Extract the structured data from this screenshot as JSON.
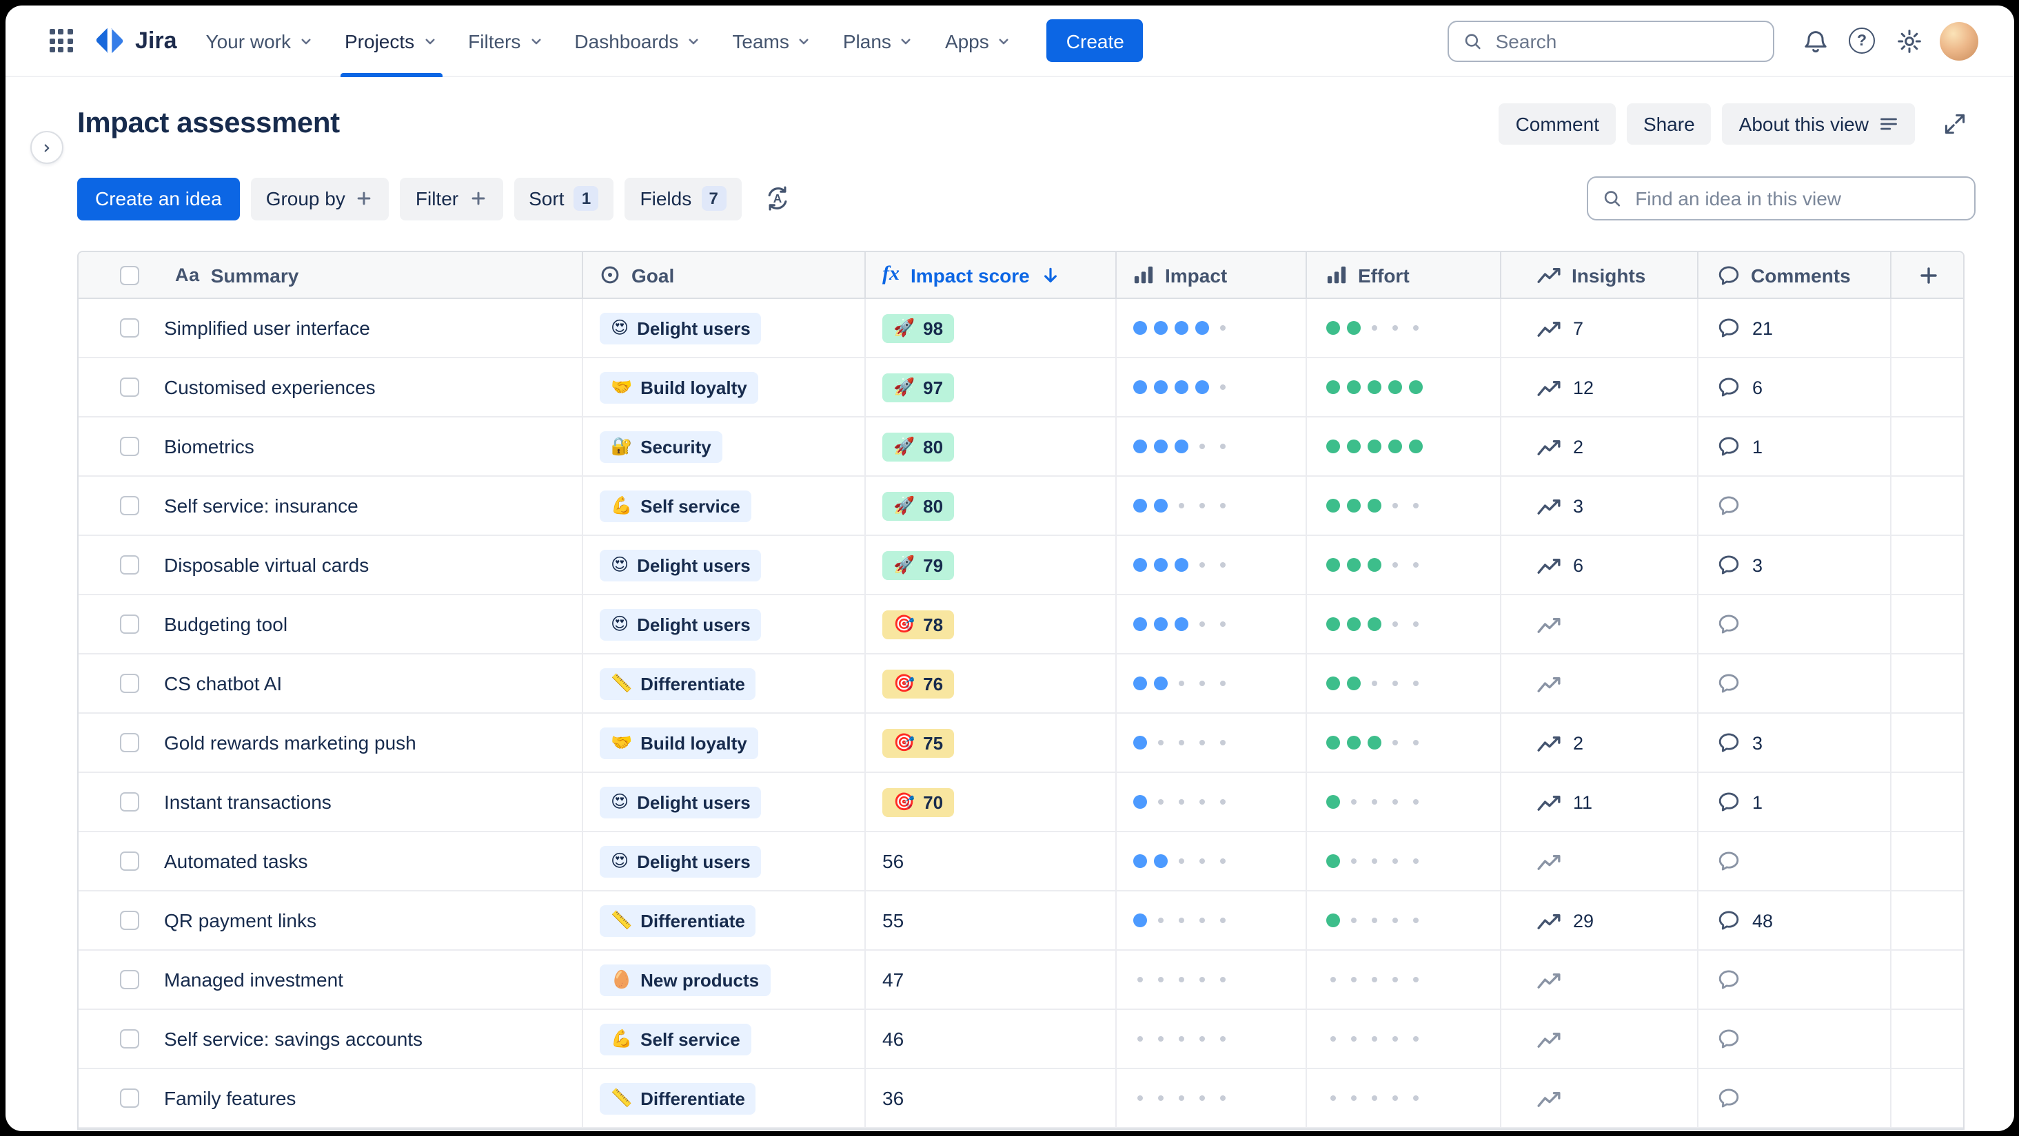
{
  "nav": {
    "brand": "Jira",
    "items": [
      {
        "label": "Your work",
        "active": false
      },
      {
        "label": "Projects",
        "active": true
      },
      {
        "label": "Filters",
        "active": false
      },
      {
        "label": "Dashboards",
        "active": false
      },
      {
        "label": "Teams",
        "active": false
      },
      {
        "label": "Plans",
        "active": false
      },
      {
        "label": "Apps",
        "active": false
      }
    ],
    "create_label": "Create",
    "search_placeholder": "Search"
  },
  "header": {
    "title": "Impact assessment",
    "actions": {
      "comment": "Comment",
      "share": "Share",
      "about": "About this view"
    }
  },
  "toolbar": {
    "create_idea": "Create an idea",
    "group_by": "Group by",
    "filter": "Filter",
    "sort": "Sort",
    "sort_count": "1",
    "fields": "Fields",
    "fields_count": "7",
    "find_placeholder": "Find an idea in this view"
  },
  "colors": {
    "brand_blue": "#0C66E4",
    "impact_dot": "#4C9AFF",
    "effort_dot": "#3DBE8B",
    "score_high_bg": "#BAF3DB",
    "score_mid_bg": "#F8E6A0",
    "goal_chip_bg": "#E9F2FF"
  },
  "table": {
    "columns": {
      "summary_icon": "Aa",
      "summary": "Summary",
      "goal": "Goal",
      "impact_score_fn": "fx",
      "impact_score": "Impact score",
      "impact": "Impact",
      "effort": "Effort",
      "insights": "Insights",
      "comments": "Comments"
    },
    "rows": [
      {
        "summary": "Simplified user interface",
        "goal_emoji": "😍",
        "goal": "Delight users",
        "score_emoji": "🚀",
        "score": "98",
        "score_tone": "high",
        "impact": 4,
        "effort": 2,
        "insights": "7",
        "comments": "21"
      },
      {
        "summary": "Customised experiences",
        "goal_emoji": "🤝",
        "goal": "Build loyalty",
        "score_emoji": "🚀",
        "score": "97",
        "score_tone": "high",
        "impact": 4,
        "effort": 5,
        "insights": "12",
        "comments": "6"
      },
      {
        "summary": "Biometrics",
        "goal_emoji": "🔐",
        "goal": "Security",
        "score_emoji": "🚀",
        "score": "80",
        "score_tone": "high",
        "impact": 3,
        "effort": 5,
        "insights": "2",
        "comments": "1"
      },
      {
        "summary": "Self service: insurance",
        "goal_emoji": "💪",
        "goal": "Self service",
        "score_emoji": "🚀",
        "score": "80",
        "score_tone": "high",
        "impact": 2,
        "effort": 3,
        "insights": "3",
        "comments": ""
      },
      {
        "summary": "Disposable virtual cards",
        "goal_emoji": "😍",
        "goal": "Delight users",
        "score_emoji": "🚀",
        "score": "79",
        "score_tone": "high",
        "impact": 3,
        "effort": 3,
        "insights": "6",
        "comments": "3"
      },
      {
        "summary": "Budgeting tool",
        "goal_emoji": "😍",
        "goal": "Delight users",
        "score_emoji": "🎯",
        "score": "78",
        "score_tone": "mid",
        "impact": 3,
        "effort": 3,
        "insights": "",
        "comments": ""
      },
      {
        "summary": "CS chatbot AI",
        "goal_emoji": "📏",
        "goal": "Differentiate",
        "score_emoji": "🎯",
        "score": "76",
        "score_tone": "mid",
        "impact": 2,
        "effort": 2,
        "insights": "",
        "comments": ""
      },
      {
        "summary": "Gold rewards marketing push",
        "goal_emoji": "🤝",
        "goal": "Build loyalty",
        "score_emoji": "🎯",
        "score": "75",
        "score_tone": "mid",
        "impact": 1,
        "effort": 3,
        "insights": "2",
        "comments": "3"
      },
      {
        "summary": "Instant transactions",
        "goal_emoji": "😍",
        "goal": "Delight users",
        "score_emoji": "🎯",
        "score": "70",
        "score_tone": "mid",
        "impact": 1,
        "effort": 1,
        "insights": "11",
        "comments": "1"
      },
      {
        "summary": "Automated tasks",
        "goal_emoji": "😍",
        "goal": "Delight users",
        "score_emoji": "",
        "score": "56",
        "score_tone": "none",
        "impact": 2,
        "effort": 1,
        "insights": "",
        "comments": ""
      },
      {
        "summary": "QR payment links",
        "goal_emoji": "📏",
        "goal": "Differentiate",
        "score_emoji": "",
        "score": "55",
        "score_tone": "none",
        "impact": 1,
        "effort": 1,
        "insights": "29",
        "comments": "48"
      },
      {
        "summary": "Managed investment",
        "goal_emoji": "🥚",
        "goal": "New products",
        "score_emoji": "",
        "score": "47",
        "score_tone": "none",
        "impact": 0,
        "effort": 0,
        "insights": "",
        "comments": ""
      },
      {
        "summary": "Self service: savings accounts",
        "goal_emoji": "💪",
        "goal": "Self service",
        "score_emoji": "",
        "score": "46",
        "score_tone": "none",
        "impact": 0,
        "effort": 0,
        "insights": "",
        "comments": ""
      },
      {
        "summary": "Family features",
        "goal_emoji": "📏",
        "goal": "Differentiate",
        "score_emoji": "",
        "score": "36",
        "score_tone": "none",
        "impact": 0,
        "effort": 0,
        "insights": "",
        "comments": ""
      }
    ]
  }
}
